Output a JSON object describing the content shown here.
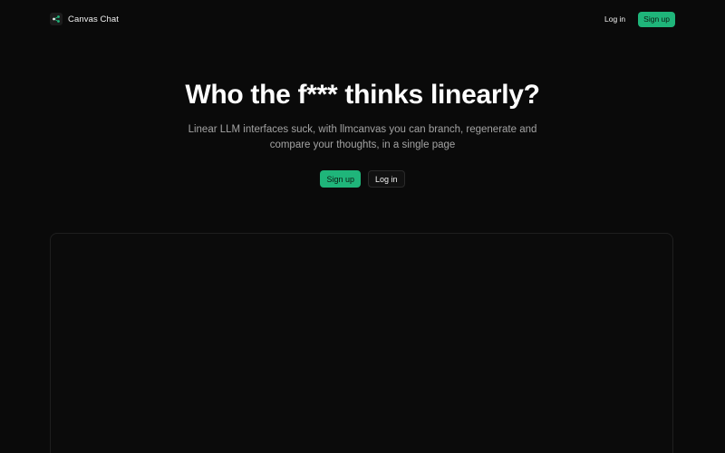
{
  "header": {
    "brand_name": "Canvas Chat",
    "logo_icon": "share-nodes-icon",
    "login_label": "Log in",
    "signup_label": "Sign up"
  },
  "hero": {
    "title": "Who the f*** thinks linearly?",
    "subtitle": "Linear LLM interfaces suck, with llmcanvas you can branch, regenerate and compare your thoughts, in a single page",
    "signup_label": "Sign up",
    "login_label": "Log in"
  },
  "colors": {
    "background": "#0a0a0a",
    "accent": "#1fb57a",
    "text_muted": "#a3a3a3"
  }
}
